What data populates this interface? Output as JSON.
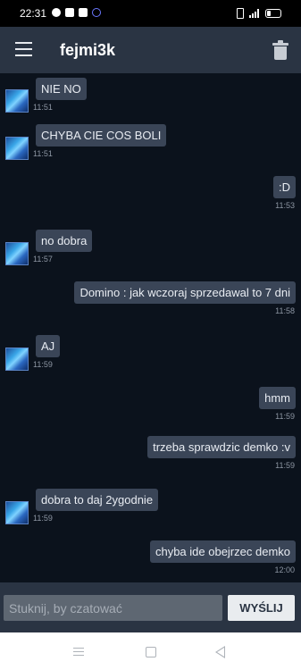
{
  "status_bar": {
    "time": "22:31",
    "icons": [
      "messenger-icon",
      "facebook-icon",
      "youtube-icon",
      "tor-icon"
    ],
    "right_icons": [
      "vibrate-icon",
      "signal-icon",
      "battery-icon"
    ]
  },
  "header": {
    "title": "fejmi3k",
    "menu_icon": "hamburger-menu-icon",
    "delete_icon": "trash-icon"
  },
  "messages": [
    {
      "side": "left",
      "text": "NIE NO",
      "time": "11:51"
    },
    {
      "side": "left",
      "text": "CHYBA CIE COS BOLI",
      "time": "11:51"
    },
    {
      "side": "right",
      "text": ":D",
      "time": "11:53"
    },
    {
      "side": "left",
      "text": "no dobra",
      "time": "11:57"
    },
    {
      "side": "right",
      "text": "Domino : jak wczoraj sprzedawal to 7 dni",
      "time": "11:58"
    },
    {
      "side": "left",
      "text": "AJ",
      "time": "11:59"
    },
    {
      "side": "right",
      "text": "hmm",
      "time": "11:59"
    },
    {
      "side": "right",
      "text": "trzeba sprawdzic demko :v",
      "time": "11:59"
    },
    {
      "side": "left",
      "text": "dobra to daj 2ygodnie",
      "time": "11:59"
    },
    {
      "side": "right",
      "text": "chyba ide obejrzec demko",
      "time": "12:00"
    }
  ],
  "composer": {
    "placeholder": "Stuknij, by czatować",
    "send_label": "WYŚLIJ"
  },
  "nav_bar": {
    "icons": [
      "recent-apps-icon",
      "home-icon",
      "back-icon"
    ]
  }
}
